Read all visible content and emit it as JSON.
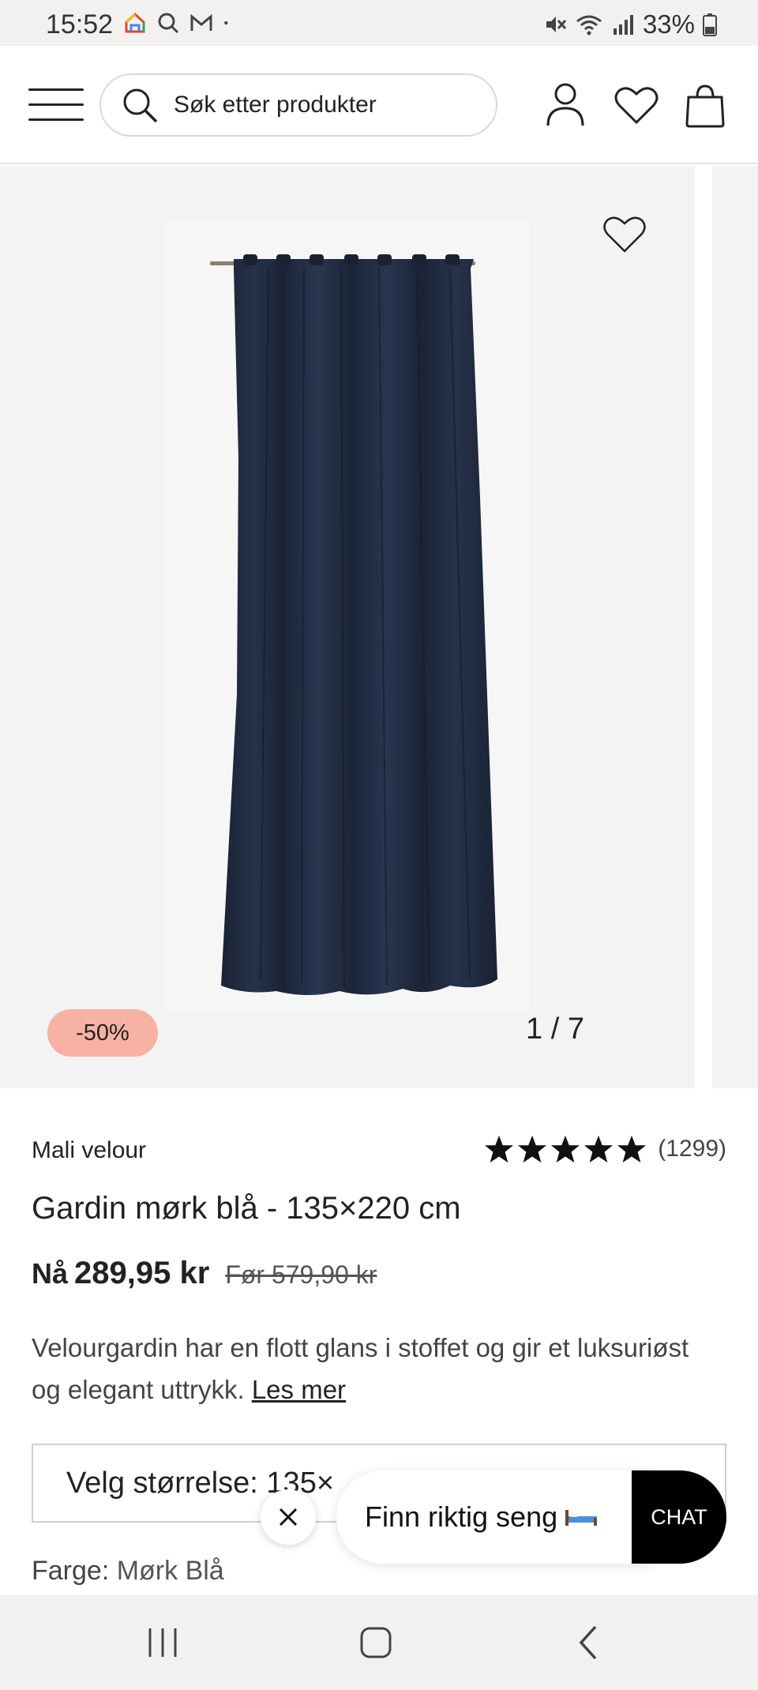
{
  "status_bar": {
    "time": "15:52",
    "battery": "33%",
    "icons": [
      "home-icon",
      "search-icon",
      "gmail-icon",
      "dot-icon",
      "mute-icon",
      "wifi-icon",
      "signal-icon",
      "battery-icon"
    ]
  },
  "header": {
    "search_placeholder": "Søk etter produkter",
    "icons": [
      "menu-icon",
      "search-icon",
      "account-icon",
      "wishlist-icon",
      "cart-icon"
    ]
  },
  "gallery": {
    "discount_badge": "-50%",
    "counter": "1 / 7",
    "curtain_color": "#1f2a3c"
  },
  "product": {
    "brand": "Mali velour",
    "rating_stars": 5,
    "review_count": "(1299)",
    "title": "Gardin mørk blå - 135×220 cm",
    "price_now_label": "Nå",
    "price_now": "289,95 kr",
    "price_before": "Før 579,90 kr",
    "description": "Velourgardin har en flott glans i stoffet og gir et luksuriøst og elegant uttrykk.",
    "read_more": "Les mer",
    "size_select": "Velg størrelse: 135×",
    "color_label": "Farge:",
    "color_value": "Mørk Blå"
  },
  "chat": {
    "prompt": "Finn riktig seng",
    "button": "CHAT"
  },
  "colors": {
    "badge_bg": "#f7b2a3",
    "chat_bg": "#000000",
    "status_bg": "#f3f1f0"
  }
}
